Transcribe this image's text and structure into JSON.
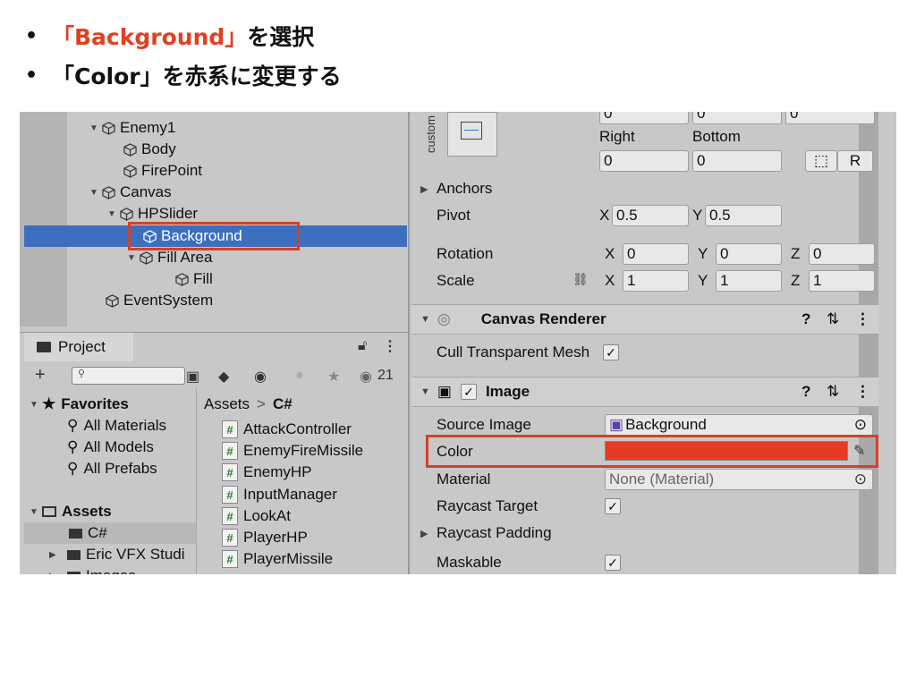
{
  "slide": {
    "bullets": [
      {
        "bullet": "•",
        "highlight": "「Background」",
        "rest": "を選択"
      },
      {
        "bullet": "•",
        "text": "「Color」を赤系に変更する"
      }
    ]
  },
  "hierarchy": {
    "items": [
      {
        "label": "Enemy1",
        "expanded": true
      },
      {
        "label": "Body"
      },
      {
        "label": "FirePoint"
      },
      {
        "label": "Canvas",
        "expanded": true
      },
      {
        "label": "HPSlider",
        "expanded": true
      },
      {
        "label": "Background",
        "selected": true
      },
      {
        "label": "Fill Area",
        "expanded": true
      },
      {
        "label": "Fill"
      },
      {
        "label": "EventSystem"
      }
    ]
  },
  "project": {
    "tab_label": "Project",
    "search_placeholder": "",
    "hidden_count": "21",
    "favorites": {
      "title": "Favorites",
      "items": [
        "All Materials",
        "All Models",
        "All Prefabs"
      ]
    },
    "assets": {
      "title": "Assets",
      "items": [
        "C#",
        "Eric VFX Studi",
        "Images"
      ]
    },
    "breadcrumb": {
      "root": "Assets",
      "sep": ">",
      "current": "C#"
    },
    "files": [
      "AttackController",
      "EnemyFireMissile",
      "EnemyHP",
      "InputManager",
      "LookAt",
      "PlayerHP",
      "PlayerMissile"
    ]
  },
  "inspector": {
    "rect": {
      "custom_label": "custom",
      "top_values": [
        "0",
        "0",
        "0"
      ],
      "right_label": "Right",
      "bottom_label": "Bottom",
      "right_value": "0",
      "bottom_value": "0",
      "r_button": "R"
    },
    "anchors_label": "Anchors",
    "pivot": {
      "label": "Pivot",
      "x_label": "X",
      "x": "0.5",
      "y_label": "Y",
      "y": "0.5"
    },
    "rotation": {
      "label": "Rotation",
      "x": "0",
      "y": "0",
      "z": "0"
    },
    "scale": {
      "label": "Scale",
      "x": "1",
      "y": "1",
      "z": "1"
    },
    "axis": {
      "x": "X",
      "y": "Y",
      "z": "Z"
    },
    "canvas_renderer": {
      "title": "Canvas Renderer",
      "cull_label": "Cull Transparent Mesh",
      "cull_checked": true
    },
    "image": {
      "title": "Image",
      "enabled": true,
      "source_image_label": "Source Image",
      "source_image_value": "Background",
      "color_label": "Color",
      "color_value": "#e53a25",
      "material_label": "Material",
      "material_value": "None (Material)",
      "raycast_target_label": "Raycast Target",
      "raycast_target_checked": true,
      "raycast_padding_label": "Raycast Padding",
      "maskable_label": "Maskable",
      "maskable_checked": true
    }
  },
  "colors": {
    "accent_red": "#d6402a",
    "selection_blue": "#3d6fbf",
    "slide_highlight": "#e2401f"
  }
}
